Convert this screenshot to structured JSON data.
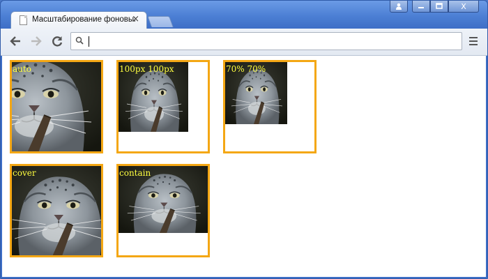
{
  "window": {
    "tab_title": "Масштабирование фоновых",
    "tab_close": "×",
    "controls": {
      "profile": "👤",
      "minimize": "–",
      "maximize": "▭",
      "close": "X"
    }
  },
  "toolbar": {
    "back": "←",
    "forward": "→",
    "reload": "C",
    "address_value": "",
    "menu": "≡"
  },
  "examples": [
    {
      "label": "auto"
    },
    {
      "label": "100px 100px"
    },
    {
      "label": "70% 70%"
    },
    {
      "label": "cover"
    },
    {
      "label": "contain"
    }
  ],
  "colors": {
    "box_border": "#f4a714",
    "label_text": "#ffff40"
  }
}
